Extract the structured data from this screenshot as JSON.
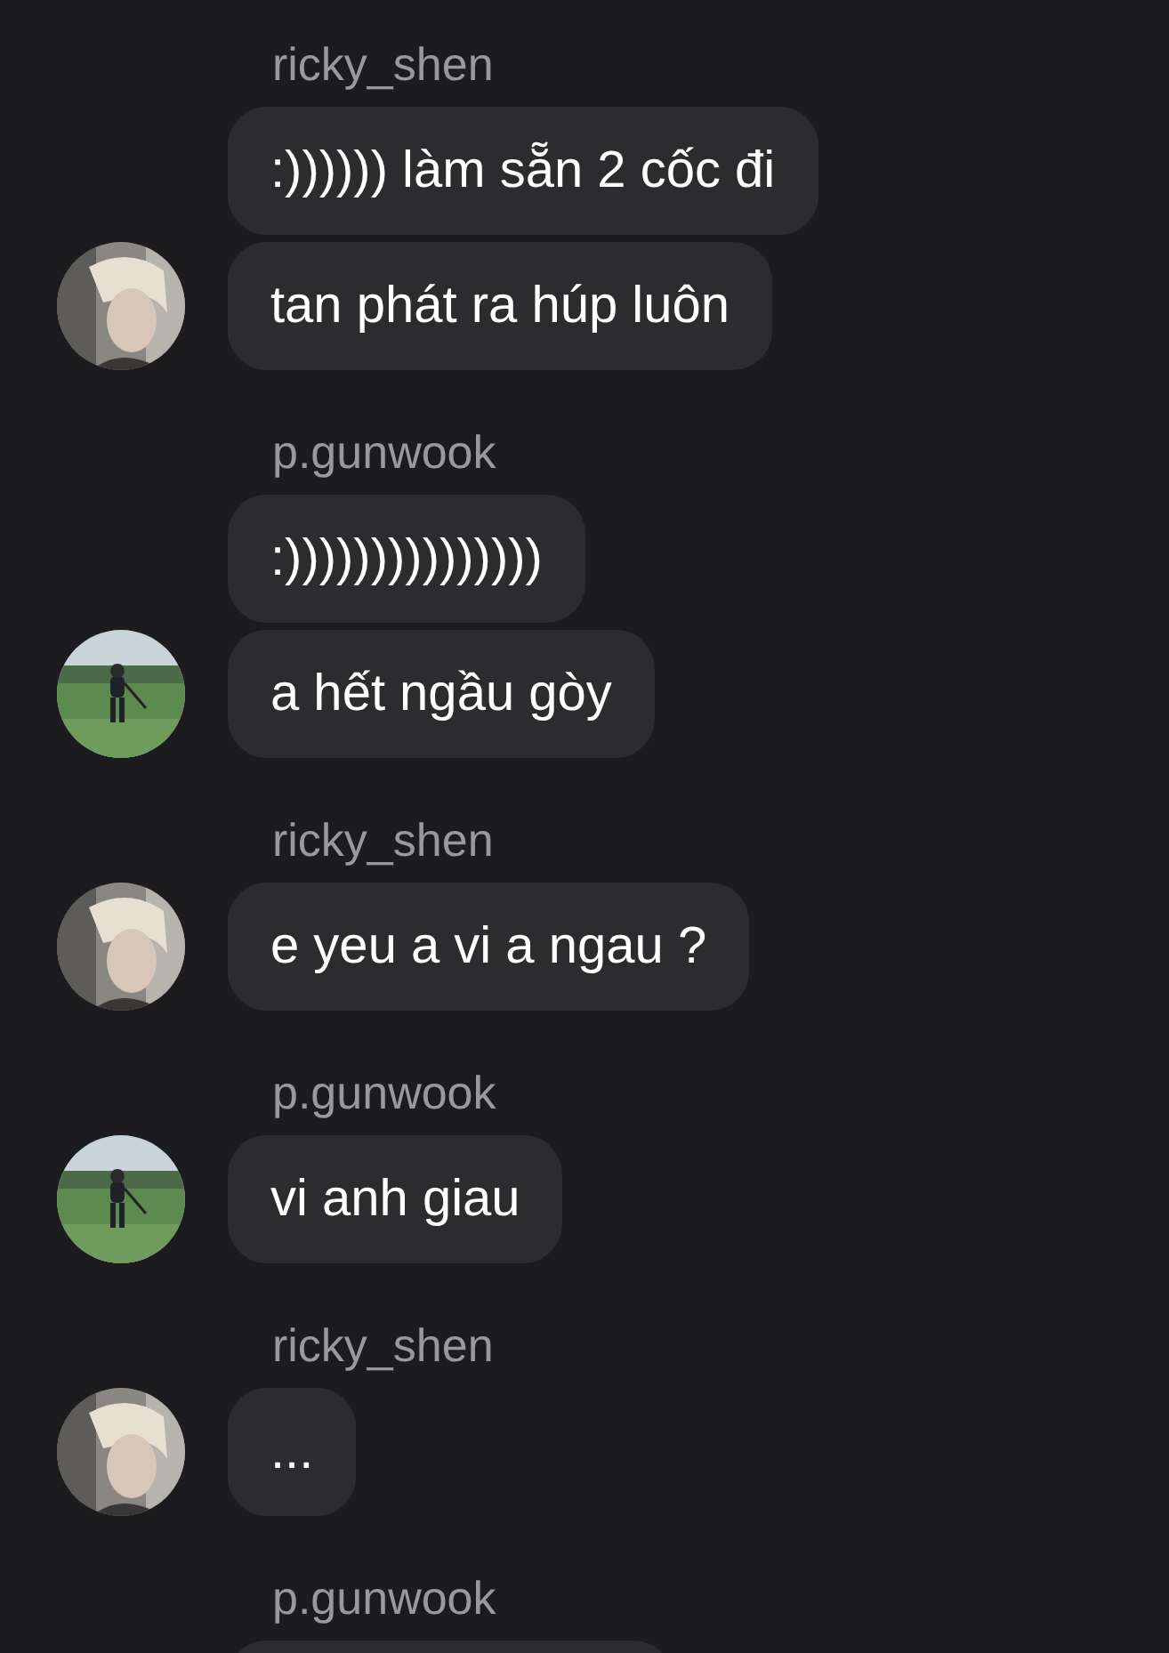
{
  "groups": [
    {
      "author": "ricky_shen",
      "avatar": {
        "kind": "portrait"
      },
      "messages": [
        ":)))))) làm sẵn 2 cốc đi",
        "tan phát ra húp luôn"
      ]
    },
    {
      "author": "p.gunwook",
      "avatar": {
        "kind": "field"
      },
      "messages": [
        ":)))))))))))))))",
        "a hết ngầu gòy"
      ]
    },
    {
      "author": "ricky_shen",
      "avatar": {
        "kind": "portrait"
      },
      "messages": [
        "e yeu a vi a ngau ?"
      ]
    },
    {
      "author": "p.gunwook",
      "avatar": {
        "kind": "field"
      },
      "messages": [
        "vi anh giau"
      ]
    },
    {
      "author": "ricky_shen",
      "avatar": {
        "kind": "portrait"
      },
      "messages": [
        "..."
      ]
    },
    {
      "author": "p.gunwook",
      "cut_off_bubble": true
    }
  ]
}
